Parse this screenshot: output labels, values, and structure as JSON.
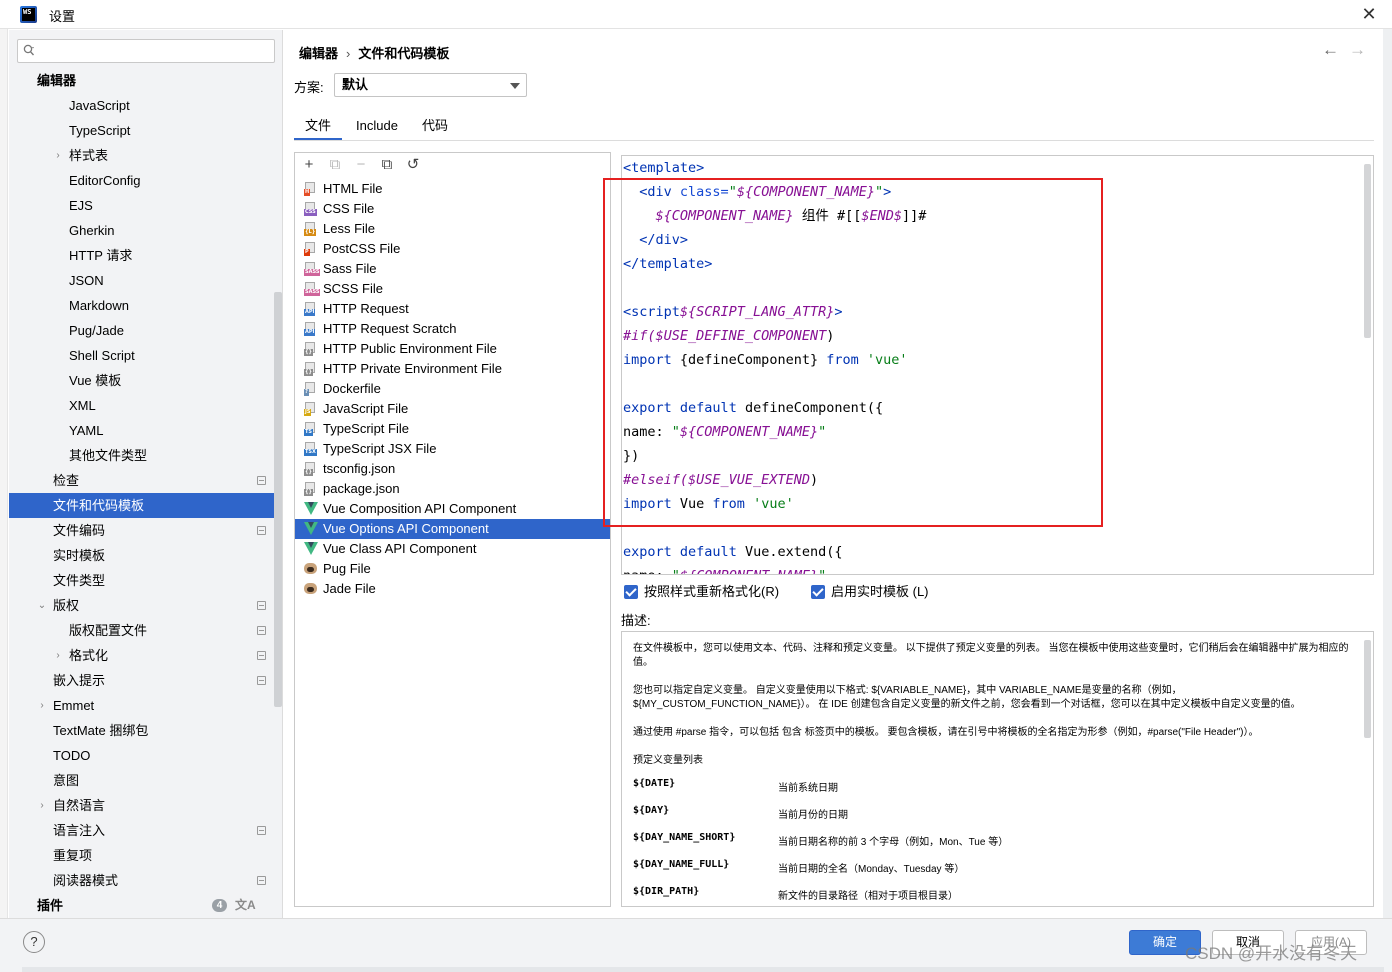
{
  "window": {
    "title": "设置",
    "close": "✕",
    "app_icon_text": "WS"
  },
  "sidebar": {
    "search_placeholder": "",
    "items": [
      {
        "label": "编辑器",
        "level": 0,
        "bold": true
      },
      {
        "label": "JavaScript",
        "level": 2
      },
      {
        "label": "TypeScript",
        "level": 2
      },
      {
        "label": "样式表",
        "level": 2,
        "chevron": "›"
      },
      {
        "label": "EditorConfig",
        "level": 2
      },
      {
        "label": "EJS",
        "level": 2
      },
      {
        "label": "Gherkin",
        "level": 2
      },
      {
        "label": "HTTP 请求",
        "level": 2
      },
      {
        "label": "JSON",
        "level": 2
      },
      {
        "label": "Markdown",
        "level": 2
      },
      {
        "label": "Pug/Jade",
        "level": 2
      },
      {
        "label": "Shell Script",
        "level": 2
      },
      {
        "label": "Vue 模板",
        "level": 2
      },
      {
        "label": "XML",
        "level": 2
      },
      {
        "label": "YAML",
        "level": 2
      },
      {
        "label": "其他文件类型",
        "level": 2
      },
      {
        "label": "检查",
        "level": 1,
        "badge": true
      },
      {
        "label": "文件和代码模板",
        "level": 1,
        "selected": true
      },
      {
        "label": "文件编码",
        "level": 1,
        "badge": true
      },
      {
        "label": "实时模板",
        "level": 1
      },
      {
        "label": "文件类型",
        "level": 1
      },
      {
        "label": "版权",
        "level": 1,
        "chevron": "⌄",
        "badge": true
      },
      {
        "label": "版权配置文件",
        "level": 2,
        "badge": true
      },
      {
        "label": "格式化",
        "level": 2,
        "chevron": "›",
        "badge": true
      },
      {
        "label": "嵌入提示",
        "level": 1,
        "badge": true
      },
      {
        "label": "Emmet",
        "level": 1,
        "chevron": "›"
      },
      {
        "label": "TextMate 捆绑包",
        "level": 1
      },
      {
        "label": "TODO",
        "level": 1
      },
      {
        "label": "意图",
        "level": 1
      },
      {
        "label": "自然语言",
        "level": 1,
        "chevron": "›"
      },
      {
        "label": "语言注入",
        "level": 1,
        "badge": true
      },
      {
        "label": "重复项",
        "level": 1
      },
      {
        "label": "阅读器模式",
        "level": 1,
        "badge": true
      },
      {
        "label": "插件",
        "level": 0,
        "bold": true,
        "count": "4"
      }
    ]
  },
  "breadcrumb": {
    "parent": "编辑器",
    "sep": "›",
    "current": "文件和代码模板"
  },
  "nav": {
    "back": "←",
    "forward": "→"
  },
  "scheme": {
    "label": "方案:",
    "value": "默认"
  },
  "tabs": [
    {
      "label": "文件",
      "active": true
    },
    {
      "label": "Include"
    },
    {
      "label": "代码"
    }
  ],
  "toolbar": {
    "add": "+",
    "copy_disabled": "⧉",
    "remove": "−",
    "duplicate": "⧉",
    "reset": "↺"
  },
  "files": [
    {
      "name": "HTML File",
      "tag": "H",
      "tagColor": "#e44d26"
    },
    {
      "name": "CSS File",
      "tag": "CSS",
      "tagColor": "#8a5fbf"
    },
    {
      "name": "Less File",
      "tag": "{L}",
      "tagColor": "#d68b14"
    },
    {
      "name": "PostCSS File",
      "tag": "P",
      "tagColor": "#dd3a0a"
    },
    {
      "name": "Sass File",
      "tag": "SASS",
      "tagColor": "#cf649a"
    },
    {
      "name": "SCSS File",
      "tag": "SASS",
      "tagColor": "#cf649a"
    },
    {
      "name": "HTTP Request",
      "tag": "API",
      "tagColor": "#3a79c9"
    },
    {
      "name": "HTTP Request Scratch",
      "tag": "API",
      "tagColor": "#3a79c9"
    },
    {
      "name": "HTTP Public Environment File",
      "tag": "{}",
      "tagColor": "#8c8c8c"
    },
    {
      "name": "HTTP Private Environment File",
      "tag": "{}",
      "tagColor": "#8c8c8c"
    },
    {
      "name": "Dockerfile",
      "tag": "?",
      "tagColor": "#6a8fb5"
    },
    {
      "name": "JavaScript File",
      "tag": "JS",
      "tagColor": "#d6a912"
    },
    {
      "name": "TypeScript File",
      "tag": "TS",
      "tagColor": "#3178c6"
    },
    {
      "name": "TypeScript JSX File",
      "tag": "TSX",
      "tagColor": "#3178c6"
    },
    {
      "name": "tsconfig.json",
      "tag": "{}",
      "tagColor": "#8c8c8c"
    },
    {
      "name": "package.json",
      "tag": "{}",
      "tagColor": "#8c8c8c"
    },
    {
      "name": "Vue Composition API Component",
      "icon": "vue"
    },
    {
      "name": "Vue Options API Component",
      "icon": "vue",
      "selected": true
    },
    {
      "name": "Vue Class API Component",
      "icon": "vue"
    },
    {
      "name": "Pug File",
      "icon": "pug"
    },
    {
      "name": "Jade File",
      "icon": "pug"
    }
  ],
  "code": [
    [
      {
        "t": "<template>",
        "c": "tag"
      }
    ],
    [
      {
        "t": "  <div ",
        "c": "tag"
      },
      {
        "t": "class=",
        "c": "attr"
      },
      {
        "t": "\"",
        "c": "str"
      },
      {
        "t": "${COMPONENT_NAME}",
        "c": "var"
      },
      {
        "t": "\"",
        "c": "str"
      },
      {
        "t": ">",
        "c": "tag"
      }
    ],
    [
      {
        "t": "    "
      },
      {
        "t": "${COMPONENT_NAME}",
        "c": "var"
      },
      {
        "t": " 组件 #[["
      },
      {
        "t": "$END$",
        "c": "var"
      },
      {
        "t": "]]#"
      }
    ],
    [
      {
        "t": "  </div>",
        "c": "tag"
      }
    ],
    [
      {
        "t": "</template>",
        "c": "tag"
      }
    ],
    [
      {
        "t": ""
      }
    ],
    [
      {
        "t": "<script",
        "c": "tag"
      },
      {
        "t": "${SCRIPT_LANG_ATTR}",
        "c": "var"
      },
      {
        "t": ">",
        "c": "tag"
      }
    ],
    [
      {
        "t": "#if(",
        "c": "dir"
      },
      {
        "t": "$USE_DEFINE_COMPONENT",
        "c": "var"
      },
      {
        "t": ")"
      }
    ],
    [
      {
        "t": "import",
        "c": "kw"
      },
      {
        "t": " {defineComponent} "
      },
      {
        "t": "from",
        "c": "kw"
      },
      {
        "t": " "
      },
      {
        "t": "'vue'",
        "c": "str"
      }
    ],
    [
      {
        "t": ""
      }
    ],
    [
      {
        "t": "export",
        "c": "kw"
      },
      {
        "t": " "
      },
      {
        "t": "default",
        "c": "kw"
      },
      {
        "t": " defineComponent({"
      }
    ],
    [
      {
        "t": "name: "
      },
      {
        "t": "\"",
        "c": "str"
      },
      {
        "t": "${COMPONENT_NAME}",
        "c": "var"
      },
      {
        "t": "\"",
        "c": "str"
      }
    ],
    [
      {
        "t": "})"
      }
    ],
    [
      {
        "t": "#elseif(",
        "c": "dir"
      },
      {
        "t": "$USE_VUE_EXTEND",
        "c": "var"
      },
      {
        "t": ")"
      }
    ],
    [
      {
        "t": "import",
        "c": "kw"
      },
      {
        "t": " Vue "
      },
      {
        "t": "from",
        "c": "kw"
      },
      {
        "t": " "
      },
      {
        "t": "'vue'",
        "c": "str"
      }
    ],
    [
      {
        "t": ""
      }
    ],
    [
      {
        "t": "export",
        "c": "kw"
      },
      {
        "t": " "
      },
      {
        "t": "default",
        "c": "kw"
      },
      {
        "t": " Vue.extend({"
      }
    ],
    [
      {
        "t": "name: "
      },
      {
        "t": "\"",
        "c": "str"
      },
      {
        "t": "${COMPONENT_NAME}",
        "c": "var"
      },
      {
        "t": "\"",
        "c": "str"
      }
    ]
  ],
  "options": {
    "reformat": "按照样式重新格式化(R)",
    "live_templates": "启用实时模板 (L)"
  },
  "description": {
    "label": "描述:",
    "p1": "在文件模板中，您可以使用文本、代码、注释和预定义变量。 以下提供了预定义变量的列表。 当您在模板中使用这些变量时，它们稍后会在编辑器中扩展为相应的值。",
    "p2": "您也可以指定自定义变量。 自定义变量使用以下格式: ${VARIABLE_NAME}，其中 VARIABLE_NAME是变量的名称（例如，${MY_CUSTOM_FUNCTION_NAME}）。 在 IDE 创建包含自定义变量的新文件之前，您会看到一个对话框，您可以在其中定义模板中自定义变量的值。",
    "p3": "通过使用 #parse 指令，可以包括 包含 标签页中的模板。 要包含模板，请在引号中将模板的全名指定为形参（例如，#parse(\"File Header\")）。",
    "list_title": "预定义变量列表",
    "vars": [
      {
        "name": "${DATE}",
        "desc": "当前系统日期"
      },
      {
        "name": "${DAY}",
        "desc": "当前月份的日期"
      },
      {
        "name": "${DAY_NAME_SHORT}",
        "desc": "当前日期名称的前 3 个字母（例如，Mon、Tue 等）"
      },
      {
        "name": "${DAY_NAME_FULL}",
        "desc": "当前日期的全名（Monday、Tuesday 等）"
      },
      {
        "name": "${DIR_PATH}",
        "desc": "新文件的目录路径（相对于项目根目录）"
      }
    ]
  },
  "buttons": {
    "help": "?",
    "ok": "确定",
    "cancel": "取消",
    "apply": "应用(A)"
  },
  "watermark": "CSDN @开水没有冬天"
}
